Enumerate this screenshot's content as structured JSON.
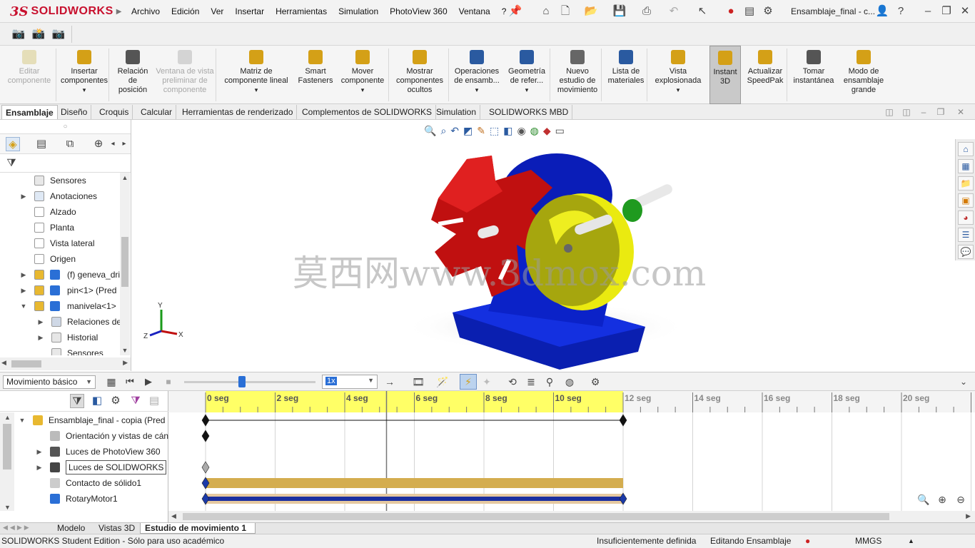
{
  "app": {
    "logo_ds": "3S",
    "logo_text": "SOLIDWORKS",
    "document_title": "Ensamblaje_final - c..."
  },
  "menu": [
    "Archivo",
    "Edición",
    "Ver",
    "Insertar",
    "Herramientas",
    "Simulation",
    "PhotoView 360",
    "Ventana",
    "?"
  ],
  "ribbon": [
    {
      "label": "Editar\ncomponente",
      "icon": "edit-component-icon",
      "disabled": true
    },
    {
      "label": "Insertar\ncomponentes",
      "icon": "insert-components-icon",
      "dropdown": true
    },
    {
      "label": "Relación\nde\nposición",
      "icon": "mate-icon"
    },
    {
      "label": "Ventana de vista\npreliminar de\ncomponente",
      "icon": "preview-window-icon",
      "disabled": true
    },
    {
      "label": "Matriz de\ncomponente lineal",
      "icon": "linear-pattern-icon",
      "dropdown": true
    },
    {
      "label": "Smart\nFasteners",
      "icon": "smart-fasteners-icon"
    },
    {
      "label": "Mover\ncomponente",
      "icon": "move-component-icon",
      "dropdown": true
    },
    {
      "label": "Mostrar\ncomponentes\nocultos",
      "icon": "show-hidden-icon"
    },
    {
      "label": "Operaciones\nde ensamb...",
      "icon": "assembly-features-icon",
      "dropdown": true
    },
    {
      "label": "Geometría\nde refer...",
      "icon": "reference-geometry-icon",
      "dropdown": true
    },
    {
      "label": "Nuevo\nestudio de\nmovimiento",
      "icon": "new-motion-study-icon"
    },
    {
      "label": "Lista de\nmateriales",
      "icon": "bom-icon"
    },
    {
      "label": "Vista\nexplosionada",
      "icon": "exploded-view-icon",
      "dropdown": true
    },
    {
      "label": "Instant\n3D",
      "icon": "instant3d-icon",
      "active": true
    },
    {
      "label": "Actualizar\nSpeedPak",
      "icon": "speedpak-icon"
    },
    {
      "label": "Tomar\ninstantánea",
      "icon": "snapshot-icon"
    },
    {
      "label": "Modo de\nensamblaje\ngrande",
      "icon": "large-assembly-icon"
    }
  ],
  "command_tabs": [
    "Ensamblaje",
    "Diseño",
    "Croquis",
    "Calcular",
    "Herramientas de renderizado",
    "Complementos de SOLIDWORKS",
    "Simulation",
    "SOLIDWORKS MBD"
  ],
  "feature_tree": [
    {
      "label": "Sensores",
      "indent": 0,
      "expander": "",
      "icon": "sensors-icon"
    },
    {
      "label": "Anotaciones",
      "indent": 0,
      "expander": "▶",
      "icon": "annotations-icon"
    },
    {
      "label": "Alzado",
      "indent": 0,
      "expander": "",
      "icon": "plane-icon"
    },
    {
      "label": "Planta",
      "indent": 0,
      "expander": "",
      "icon": "plane-icon"
    },
    {
      "label": "Vista lateral",
      "indent": 0,
      "expander": "",
      "icon": "plane-icon"
    },
    {
      "label": "Origen",
      "indent": 0,
      "expander": "",
      "icon": "origin-icon"
    },
    {
      "label": "(f) geneva_dri",
      "indent": 0,
      "expander": "▶",
      "icon": "part-icon"
    },
    {
      "label": "pin<1> (Pred",
      "indent": 0,
      "expander": "▶",
      "icon": "part-icon"
    },
    {
      "label": "manivela<1>",
      "indent": 0,
      "expander": "▼",
      "icon": "part-icon"
    },
    {
      "label": "Relaciones de",
      "indent": 1,
      "expander": "▶",
      "icon": "mates-folder-icon"
    },
    {
      "label": "Historial",
      "indent": 1,
      "expander": "▶",
      "icon": "history-icon"
    },
    {
      "label": "Sensores",
      "indent": 1,
      "expander": "",
      "icon": "sensors-icon"
    }
  ],
  "watermark": "莫西网www.3dmox.com",
  "triad": {
    "x": "X",
    "y": "Y",
    "z": "Z"
  },
  "motion": {
    "study_type": "Movimiento básico",
    "playback_speed": "1x",
    "tree": [
      {
        "label": "Ensamblaje_final - copia  (Pred",
        "expander": "▼",
        "indent": 0
      },
      {
        "label": "Orientación y vistas de cán",
        "expander": "",
        "indent": 1
      },
      {
        "label": "Luces de PhotoView 360",
        "expander": "▶",
        "indent": 1
      },
      {
        "label": "Luces de SOLIDWORKS",
        "expander": "▶",
        "indent": 1,
        "selected": true
      },
      {
        "label": "Contacto de sólido1",
        "expander": "",
        "indent": 1
      },
      {
        "label": "RotaryMotor1",
        "expander": "",
        "indent": 1
      }
    ],
    "time_labels": [
      "0 seg",
      "2 seg",
      "4 seg",
      "6 seg",
      "8 seg",
      "10 seg",
      "12 seg",
      "14 seg",
      "16 seg",
      "18 seg",
      "20 seg"
    ],
    "timeline_end_seconds": 12,
    "playhead_seconds": 5.2
  },
  "bottom_tabs": [
    "Modelo",
    "Vistas 3D",
    "Estudio de movimiento 1"
  ],
  "status": {
    "edition": "SOLIDWORKS Student Edition - Sólo para uso académico",
    "definition": "Insuficientemente definida",
    "mode": "Editando Ensamblaje",
    "units": "MMGS"
  },
  "colors": {
    "brand": "#c8102e",
    "timeline_band": "#ffff66",
    "key_bar": "#d4ad4f",
    "motor_bar": "#1b2fa0"
  }
}
